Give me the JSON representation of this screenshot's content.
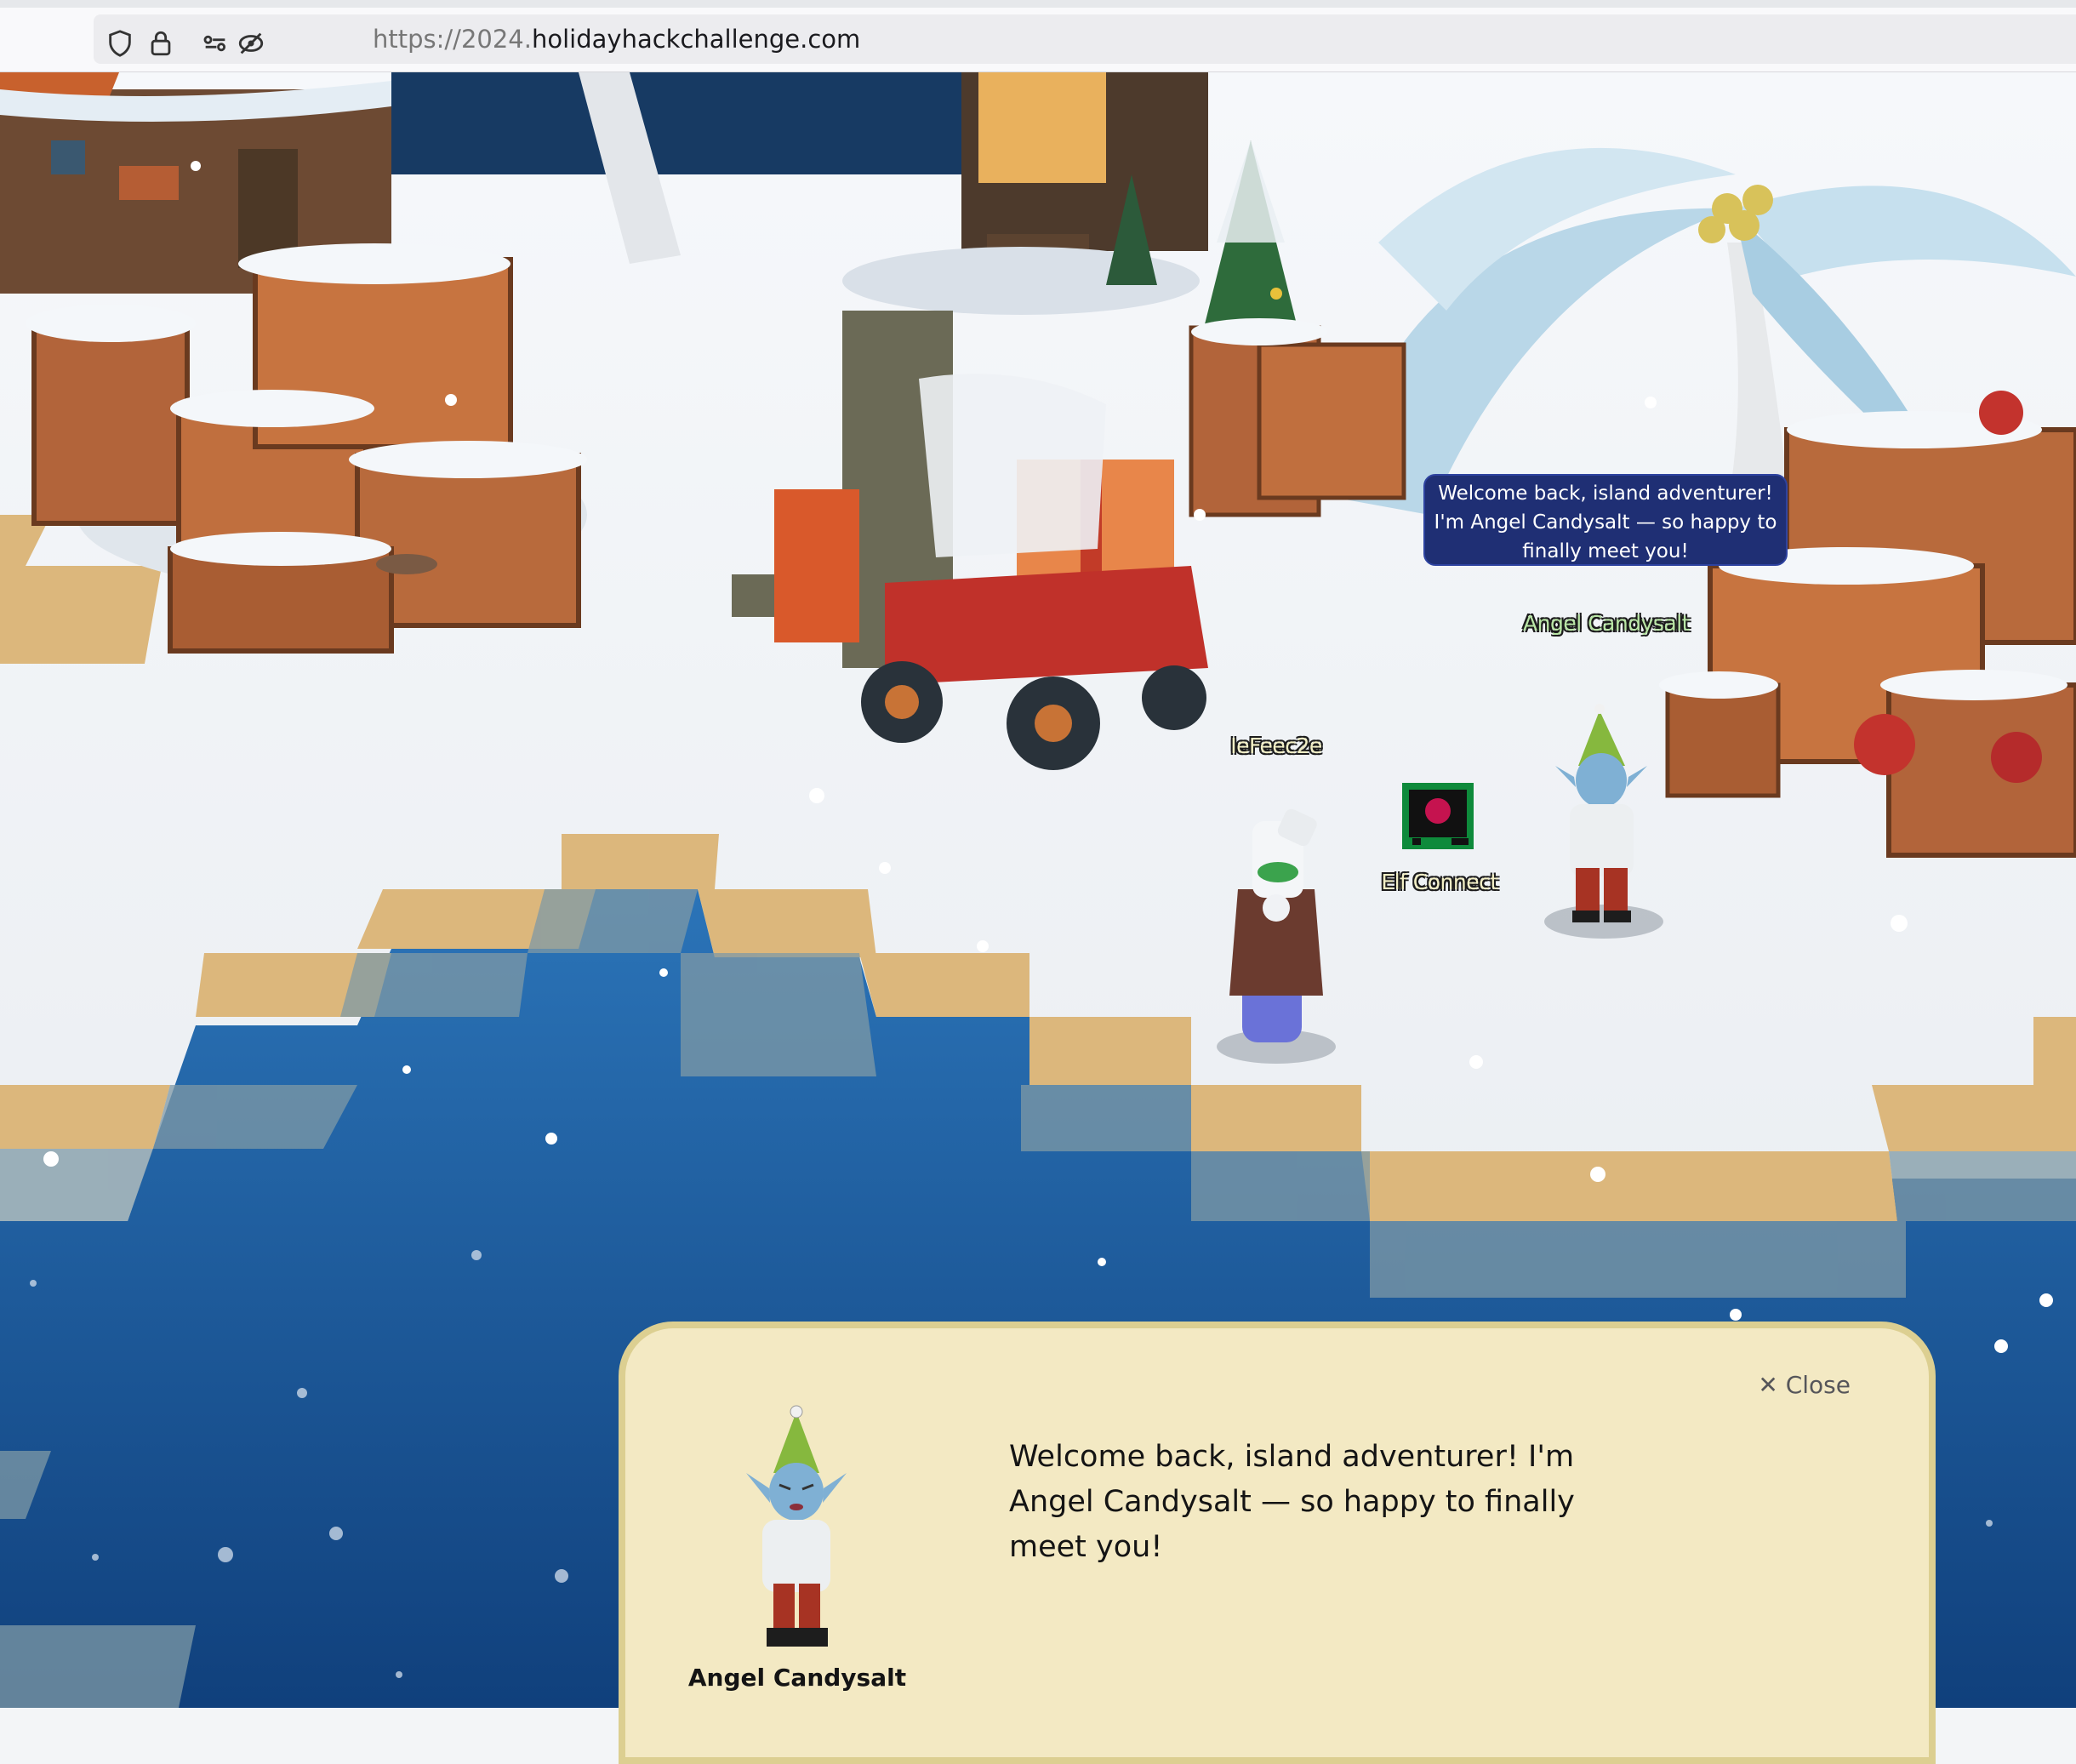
{
  "browser": {
    "url_prefix": "https://2024.",
    "url_domain": "holidayhackchallenge.com",
    "icons": [
      "shield-icon",
      "lock-icon",
      "permissions-icon",
      "tracking-blocked-icon"
    ]
  },
  "scene": {
    "player": {
      "name": "IeFeec2e"
    },
    "npc": {
      "name": "Angel Candysalt"
    },
    "terminal": {
      "label": "Elf Connect",
      "icon": "raspberry-pi-terminal-icon"
    },
    "speech_bubble": "Welcome back, island adventurer! I'm Angel Candysalt — so happy to finally meet you!"
  },
  "dialog": {
    "close_label": "✕ Close",
    "text": "Welcome back, island adventurer! I'm Angel Candysalt — so happy to finally meet you!",
    "speaker_name": "Angel Candysalt"
  },
  "colors": {
    "water": "#1f5f9f",
    "sand": "#dcb77c",
    "snow": "#eef1f4",
    "bubble": "#1f2f74",
    "dialog_bg": "#f3e9c3",
    "dialog_border": "#dccf91"
  }
}
